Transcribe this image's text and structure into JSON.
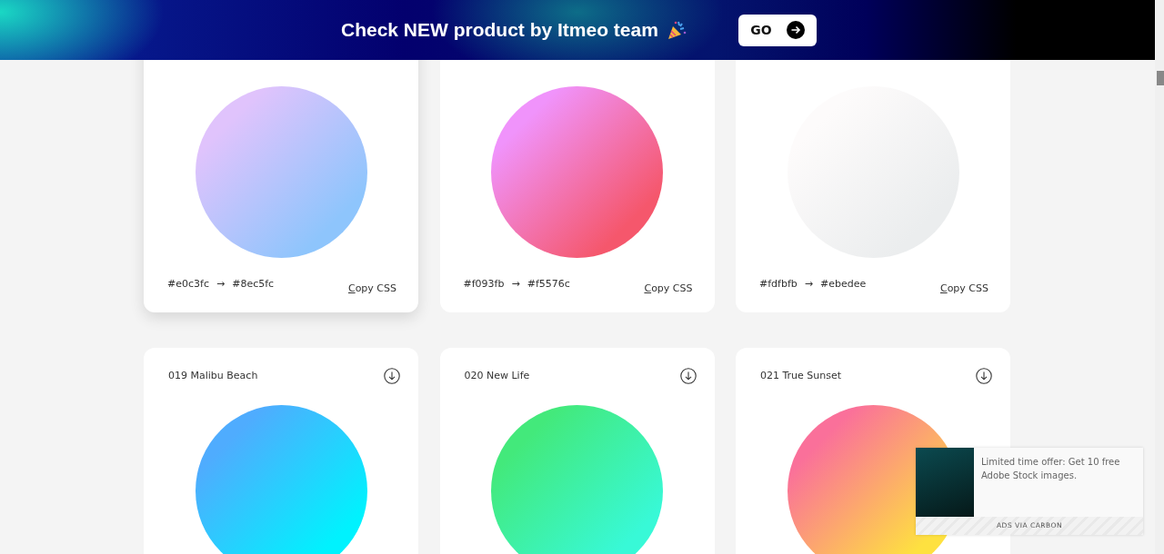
{
  "banner": {
    "text": "Check NEW product by Itmeo team",
    "button": "GO"
  },
  "rows": [
    {
      "cards": [
        {
          "from": "#e0c3fc",
          "arrow": "→",
          "to": "#8ec5fc",
          "copy": "Copy CSS",
          "raised": true
        },
        {
          "from": "#f093fb",
          "arrow": "→",
          "to": "#f5576c",
          "copy": "Copy CSS",
          "raised": false
        },
        {
          "from": "#fdfbfb",
          "arrow": "→",
          "to": "#ebedee",
          "copy": "Copy CSS",
          "raised": false
        }
      ]
    },
    {
      "cards": [
        {
          "title": "019 Malibu Beach",
          "gradient": [
            {
              "color": "#4facfe"
            },
            {
              "color": "#00f2fe"
            }
          ],
          "raised": false
        },
        {
          "title": "020 New Life",
          "gradient": [
            {
              "color": "#43e97b"
            },
            {
              "color": "#38f9d7"
            }
          ],
          "raised": false
        },
        {
          "title": "021 True Sunset",
          "gradient": [
            {
              "color": "#fa709a"
            },
            {
              "color": "#fee140"
            }
          ],
          "raised": false
        }
      ]
    }
  ],
  "ad": {
    "text": "Limited time offer: Get 10 free Adobe Stock images.",
    "footer": "ADS VIA CARBON"
  }
}
